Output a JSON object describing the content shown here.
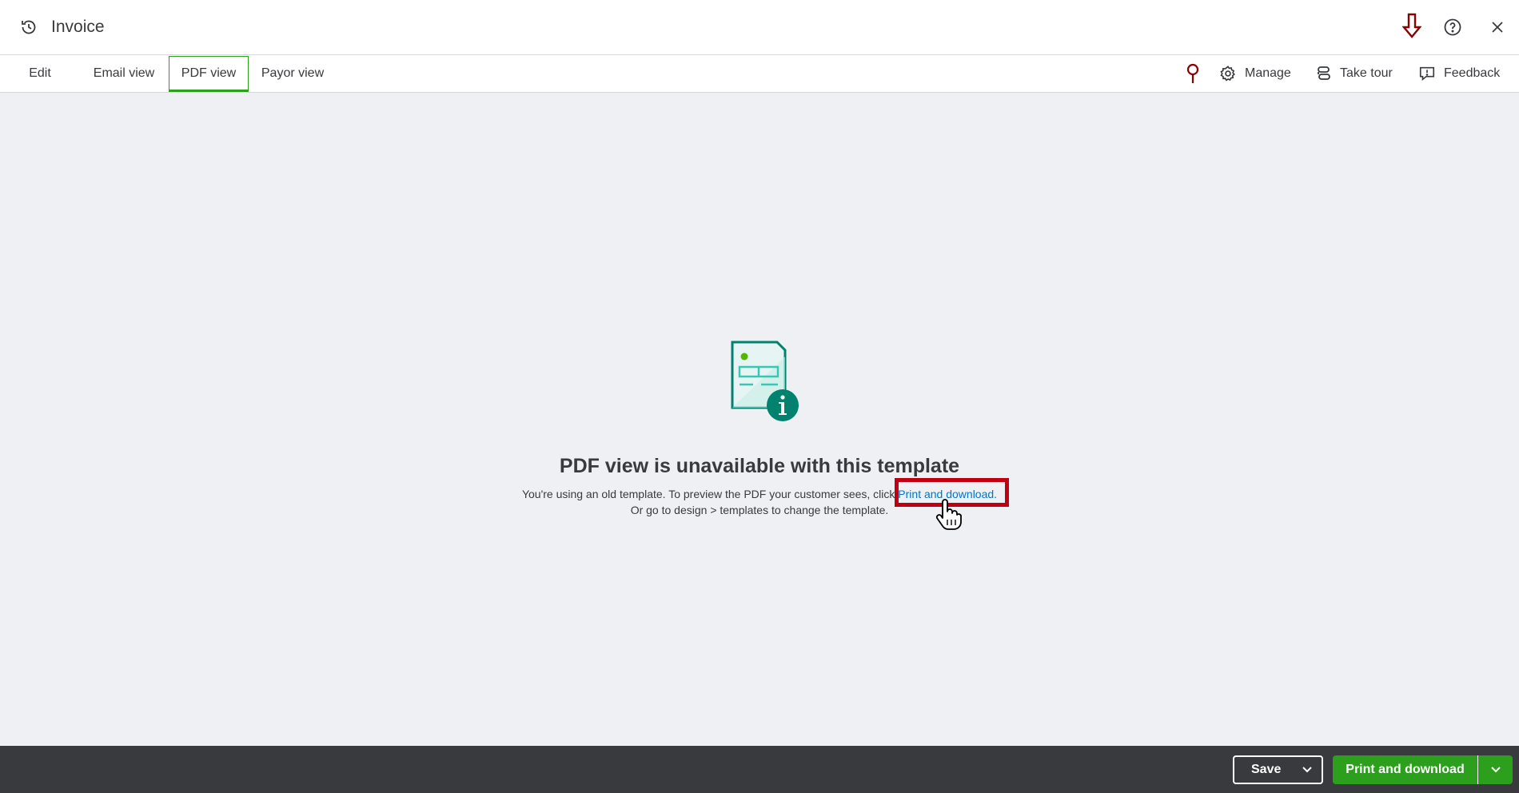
{
  "header": {
    "title": "Invoice",
    "icons": [
      "history-icon",
      "arrow-down-annotation-icon",
      "help-icon",
      "close-icon"
    ]
  },
  "tabs": [
    {
      "label": "Edit",
      "active": false
    },
    {
      "label": "Email view",
      "active": false
    },
    {
      "label": "PDF view",
      "active": true
    },
    {
      "label": "Payor view",
      "active": false
    }
  ],
  "toolbar": {
    "manage_label": "Manage",
    "tour_label": "Take tour",
    "feedback_label": "Feedback"
  },
  "main": {
    "heading": "PDF view is unavailable with this template",
    "message_prefix": "You're using an old template. To preview the PDF your customer sees, click ",
    "message_link": "Print and download.",
    "message_line2": "Or go to design > templates to change the template."
  },
  "footer": {
    "save_label": "Save",
    "print_label": "Print and download"
  },
  "colors": {
    "accent_green": "#2ca01c",
    "link_blue": "#0077c5",
    "highlight_red": "#c00012",
    "annotation_red": "#8b0000",
    "footer_bg": "#393a3d",
    "content_bg": "#eff0f4"
  }
}
